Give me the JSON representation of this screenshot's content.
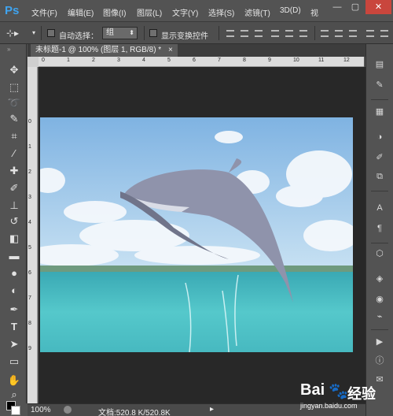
{
  "app": {
    "logo_text": "Ps"
  },
  "menu": {
    "items": [
      "文件(F)",
      "编辑(E)",
      "图像(I)",
      "图层(L)",
      "文字(Y)",
      "选择(S)",
      "滤镜(T)",
      "3D(D)",
      "视"
    ]
  },
  "window": {
    "minimize": "—",
    "maximize": "▢",
    "close": "✕"
  },
  "options": {
    "auto_select_label": "自动选择：",
    "auto_select_value": "组",
    "show_transform_label": "显示变换控件"
  },
  "document": {
    "tab_title": "未标题-1 @ 100% (图层 1, RGB/8) *",
    "tab_close": "×"
  },
  "rulers": {
    "top": [
      "0",
      "1",
      "2",
      "3",
      "4",
      "5",
      "6",
      "7",
      "8",
      "9",
      "10",
      "11",
      "12"
    ],
    "left": [
      "0",
      "1",
      "2",
      "3",
      "4",
      "5",
      "6",
      "7",
      "8",
      "9"
    ]
  },
  "status": {
    "zoom": "100%",
    "doc_info": "文档:520.8 K/520.8K"
  },
  "watermark": {
    "brand": "Bai",
    "brand2": "du",
    "sub": "经验",
    "url": "jingyan.baidu.com"
  },
  "colors": {
    "sky": "#a7cdea",
    "sea": "#4fc1c6",
    "dolphin": "#8f93ab",
    "accent": "#3fa4f0"
  }
}
